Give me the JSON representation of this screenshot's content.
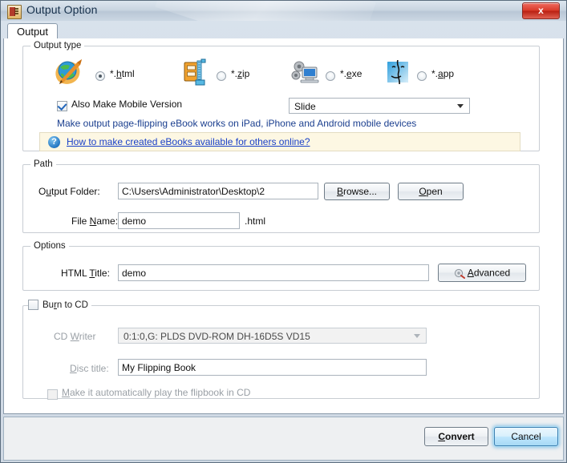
{
  "window": {
    "title": "Output Option",
    "app_icon": "book-icon",
    "close_label": "x"
  },
  "tabs": [
    {
      "label": "Output",
      "active": true
    }
  ],
  "output_type": {
    "legend": "Output type",
    "options": [
      {
        "label": "*.html",
        "underline": "h",
        "icon": "globe-html-icon",
        "selected": true
      },
      {
        "label": "*.zip",
        "underline": "z",
        "icon": "zip-archive-icon",
        "selected": false
      },
      {
        "label": "*.exe",
        "underline": "e",
        "icon": "gear-computer-exe-icon",
        "selected": false
      },
      {
        "label": "*.app",
        "underline": "a",
        "icon": "mac-finder-app-icon",
        "selected": false
      }
    ],
    "mobile_checkbox": {
      "label": "Also Make Mobile Version",
      "checked": true
    },
    "mobile_hint": "Make output page-flipping eBook works on iPad, iPhone and Android mobile devices",
    "mobile_template": {
      "value": "Slide",
      "options": [
        "Slide"
      ]
    },
    "info_bar": {
      "icon": "question-mark-icon",
      "link_text": "How to make created eBooks available for others online?"
    }
  },
  "path": {
    "legend": "Path",
    "output_folder_label": "Output Folder:",
    "output_folder_underline": "u",
    "output_folder_value": "C:\\Users\\Administrator\\Desktop\\2",
    "browse_label": "Browse...",
    "browse_underline": "B",
    "open_label": "Open",
    "open_underline": "O",
    "file_name_label": "File Name:",
    "file_name_underline": "N",
    "file_name_value": "demo",
    "file_extension": ".html"
  },
  "options": {
    "legend": "Options",
    "html_title_label": "HTML Title:",
    "html_title_underline": "T",
    "html_title_value": "demo",
    "advanced_label": "Advanced",
    "advanced_underline": "A",
    "advanced_icon": "settings-gear-icon"
  },
  "burn_to_cd": {
    "legend": "Burn to CD",
    "legend_underline": "r",
    "enabled": false,
    "cd_writer_label": "CD Writer",
    "cd_writer_underline": "W",
    "cd_writer_value": "0:1:0,G: PLDS    DVD-ROM DH-16D5S VD15",
    "disc_title_label": "Disc title:",
    "disc_title_underline": "D",
    "disc_title_value": "My Flipping Book",
    "autoplay_label": "Make it automatically play the flipbook in CD",
    "autoplay_underline": "M",
    "autoplay_checked": false
  },
  "footer": {
    "convert_label": "Convert",
    "convert_underline": "C",
    "cancel_label": "Cancel"
  },
  "colors": {
    "accent_blue": "#3c7fb1",
    "link_blue": "#1a41c8",
    "info_bg": "#fdf7e3",
    "close_red": "#d93b2b"
  }
}
